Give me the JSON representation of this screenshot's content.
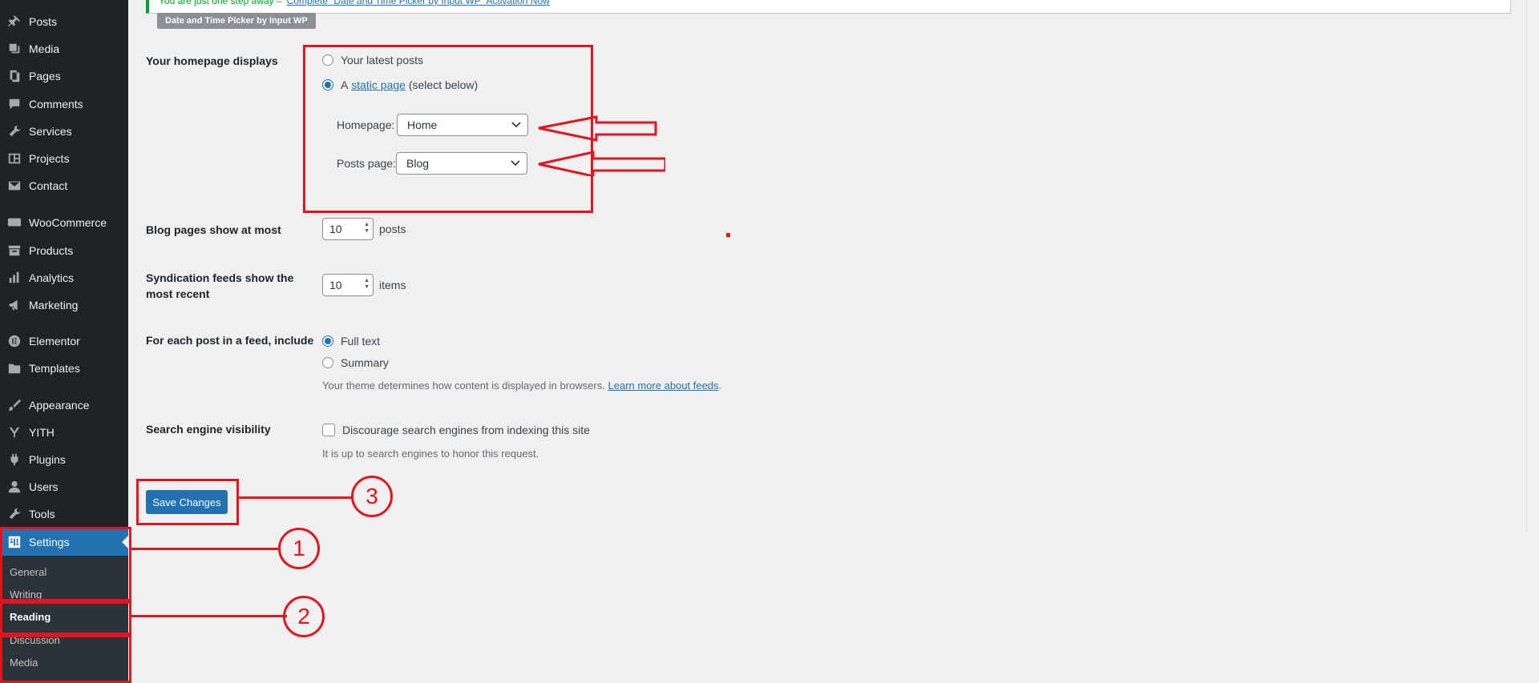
{
  "sidebar": {
    "items": [
      {
        "label": "Posts",
        "icon": "pin-icon"
      },
      {
        "label": "Media",
        "icon": "media-icon"
      },
      {
        "label": "Pages",
        "icon": "pages-icon"
      },
      {
        "label": "Comments",
        "icon": "comments-icon"
      },
      {
        "label": "Services",
        "icon": "wrench-icon"
      },
      {
        "label": "Projects",
        "icon": "portfolio-icon"
      },
      {
        "label": "Contact",
        "icon": "email-icon"
      },
      {
        "label": "WooCommerce",
        "icon": "woocommerce-icon"
      },
      {
        "label": "Products",
        "icon": "archive-icon"
      },
      {
        "label": "Analytics",
        "icon": "bar-chart-icon"
      },
      {
        "label": "Marketing",
        "icon": "megaphone-icon"
      },
      {
        "label": "Elementor",
        "icon": "elementor-icon"
      },
      {
        "label": "Templates",
        "icon": "folder-icon"
      },
      {
        "label": "Appearance",
        "icon": "paintbrush-icon"
      },
      {
        "label": "YITH",
        "icon": "yith-icon"
      },
      {
        "label": "Plugins",
        "icon": "plugin-icon"
      },
      {
        "label": "Users",
        "icon": "user-icon"
      },
      {
        "label": "Tools",
        "icon": "tools-icon"
      },
      {
        "label": "Settings",
        "icon": "settings-icon"
      }
    ],
    "submenu": [
      "General",
      "Writing",
      "Reading",
      "Discussion",
      "Media"
    ]
  },
  "notice": {
    "text": "You are just one step away –",
    "link": "Complete “Date and Time Picker by Input WP” Activation Now",
    "tag": "Date and Time Picker by Input WP"
  },
  "homepage": {
    "label": "Your homepage displays",
    "option_latest": "Your latest posts",
    "option_static_prefix": "A",
    "option_static_link": "static page",
    "option_static_suffix": "(select below)",
    "homepage_label": "Homepage:",
    "homepage_value": "Home",
    "posts_label": "Posts page:",
    "posts_value": "Blog"
  },
  "blog_pages": {
    "label": "Blog pages show at most",
    "value": "10",
    "unit": "posts"
  },
  "syndication": {
    "label_1": "Syndication feeds show the",
    "label_2": "most recent",
    "value": "10",
    "unit": "items"
  },
  "feed": {
    "label": "For each post in a feed, include",
    "option_full": "Full text",
    "option_summary": "Summary",
    "desc": "Your theme determines how content is displayed in browsers.",
    "desc_link": "Learn more about feeds"
  },
  "search": {
    "label": "Search engine visibility",
    "checkbox_label": "Discourage search engines from indexing this site",
    "desc": "It is up to search engines to honor this request."
  },
  "save_button": "Save Changes",
  "annotations": {
    "one": "1",
    "two": "2",
    "three": "3"
  },
  "colors": {
    "sidebar": "#1d2327",
    "accent": "#2271b1",
    "annotation": "#e3131f"
  }
}
